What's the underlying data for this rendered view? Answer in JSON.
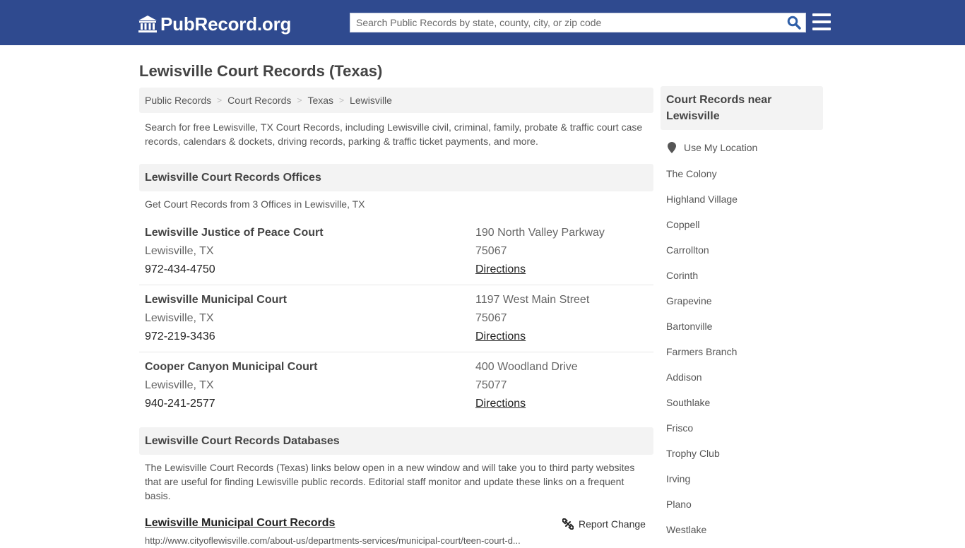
{
  "header": {
    "logo_text": "PubRecord.org",
    "search_placeholder": "Search Public Records by state, county, city, or zip code",
    "brand_color": "#2f4a8f"
  },
  "page": {
    "title": "Lewisville Court Records (Texas)",
    "breadcrumb": [
      "Public Records",
      "Court Records",
      "Texas",
      "Lewisville"
    ],
    "intro": "Search for free Lewisville, TX Court Records, including Lewisville civil, criminal, family, probate & traffic court case records, calendars & dockets, driving records, parking & traffic ticket payments, and more."
  },
  "offices": {
    "heading": "Lewisville Court Records Offices",
    "subheading": "Get Court Records from 3 Offices in Lewisville, TX",
    "items": [
      {
        "name": "Lewisville Justice of Peace Court",
        "city": "Lewisville, TX",
        "phone": "972-434-4750",
        "address": "190 North Valley Parkway",
        "zip": "75067",
        "directions_label": "Directions"
      },
      {
        "name": "Lewisville Municipal Court",
        "city": "Lewisville, TX",
        "phone": "972-219-3436",
        "address": "1197 West Main Street",
        "zip": "75067",
        "directions_label": "Directions"
      },
      {
        "name": "Cooper Canyon Municipal Court",
        "city": "Lewisville, TX",
        "phone": "940-241-2577",
        "address": "400 Woodland Drive",
        "zip": "75077",
        "directions_label": "Directions"
      }
    ]
  },
  "databases": {
    "heading": "Lewisville Court Records Databases",
    "intro": "The Lewisville Court Records (Texas) links below open in a new window and will take you to third party websites that are useful for finding Lewisville public records. Editorial staff monitor and update these links on a frequent basis.",
    "items": [
      {
        "title": "Lewisville Municipal Court Records",
        "url": "http://www.cityoflewisville.com/about-us/departments-services/municipal-court/teen-court-d...",
        "report_label": "Report Change"
      }
    ]
  },
  "sidebar": {
    "heading": "Court Records near Lewisville",
    "use_location_label": "Use My Location",
    "cities": [
      "The Colony",
      "Highland Village",
      "Coppell",
      "Carrollton",
      "Corinth",
      "Grapevine",
      "Bartonville",
      "Farmers Branch",
      "Addison",
      "Southlake",
      "Frisco",
      "Trophy Club",
      "Irving",
      "Plano",
      "Westlake"
    ]
  }
}
